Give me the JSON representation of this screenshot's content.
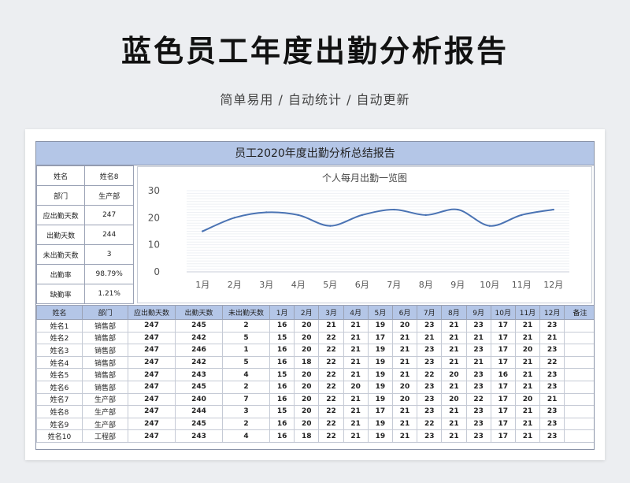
{
  "page": {
    "title": "蓝色员工年度出勤分析报告",
    "subtitle": "简单易用 / 自动统计 / 自动更新"
  },
  "report": {
    "title": "员工2020年度出勤分析总结报告"
  },
  "info_rows": [
    {
      "label": "姓名",
      "value": "姓名8"
    },
    {
      "label": "部门",
      "value": "生产部"
    },
    {
      "label": "应出勤天数",
      "value": "247"
    },
    {
      "label": "出勤天数",
      "value": "244"
    },
    {
      "label": "未出勤天数",
      "value": "3"
    },
    {
      "label": "出勤率",
      "value": "98.79%"
    },
    {
      "label": "缺勤率",
      "value": "1.21%"
    }
  ],
  "chart_data": {
    "type": "line",
    "title": "个人每月出勤一览图",
    "categories": [
      "1月",
      "2月",
      "3月",
      "4月",
      "5月",
      "6月",
      "7月",
      "8月",
      "9月",
      "10月",
      "11月",
      "12月"
    ],
    "series": [
      {
        "values": [
          15,
          20,
          22,
          21,
          17,
          21,
          23,
          21,
          23,
          17,
          21,
          23
        ]
      }
    ],
    "yticks": [
      "0",
      "10",
      "20",
      "30"
    ],
    "ylim": [
      0,
      30
    ],
    "color": "#4a73b3"
  },
  "table": {
    "headers": [
      "姓名",
      "部门",
      "应出勤天数",
      "出勤天数",
      "未出勤天数",
      "1月",
      "2月",
      "3月",
      "4月",
      "5月",
      "6月",
      "7月",
      "8月",
      "9月",
      "10月",
      "11月",
      "12月",
      "备注"
    ],
    "rows": [
      [
        "姓名1",
        "销售部",
        "247",
        "245",
        "2",
        "16",
        "20",
        "21",
        "21",
        "19",
        "20",
        "23",
        "21",
        "23",
        "17",
        "21",
        "23",
        ""
      ],
      [
        "姓名2",
        "销售部",
        "247",
        "242",
        "5",
        "15",
        "20",
        "22",
        "21",
        "17",
        "21",
        "21",
        "21",
        "21",
        "17",
        "21",
        "21",
        ""
      ],
      [
        "姓名3",
        "销售部",
        "247",
        "246",
        "1",
        "16",
        "20",
        "22",
        "21",
        "19",
        "21",
        "23",
        "21",
        "23",
        "17",
        "20",
        "23",
        ""
      ],
      [
        "姓名4",
        "销售部",
        "247",
        "242",
        "5",
        "16",
        "18",
        "22",
        "21",
        "19",
        "21",
        "23",
        "21",
        "21",
        "17",
        "21",
        "22",
        ""
      ],
      [
        "姓名5",
        "销售部",
        "247",
        "243",
        "4",
        "15",
        "20",
        "22",
        "21",
        "19",
        "21",
        "22",
        "20",
        "23",
        "16",
        "21",
        "23",
        ""
      ],
      [
        "姓名6",
        "销售部",
        "247",
        "245",
        "2",
        "16",
        "20",
        "22",
        "20",
        "19",
        "20",
        "23",
        "21",
        "23",
        "17",
        "21",
        "23",
        ""
      ],
      [
        "姓名7",
        "生产部",
        "247",
        "240",
        "7",
        "16",
        "20",
        "22",
        "21",
        "19",
        "20",
        "23",
        "20",
        "22",
        "17",
        "20",
        "21",
        ""
      ],
      [
        "姓名8",
        "生产部",
        "247",
        "244",
        "3",
        "15",
        "20",
        "22",
        "21",
        "17",
        "21",
        "23",
        "21",
        "23",
        "17",
        "21",
        "23",
        ""
      ],
      [
        "姓名9",
        "生产部",
        "247",
        "245",
        "2",
        "16",
        "20",
        "22",
        "21",
        "19",
        "21",
        "22",
        "21",
        "23",
        "17",
        "21",
        "23",
        ""
      ],
      [
        "姓名10",
        "工程部",
        "247",
        "243",
        "4",
        "16",
        "18",
        "22",
        "21",
        "19",
        "21",
        "23",
        "21",
        "23",
        "17",
        "21",
        "23",
        ""
      ]
    ]
  }
}
